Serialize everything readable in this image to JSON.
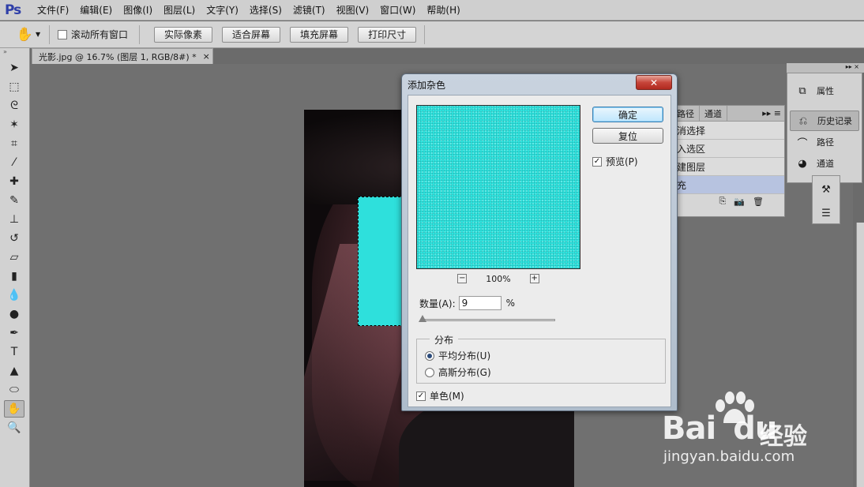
{
  "app": {
    "logo": "Ps"
  },
  "menu": [
    "文件(F)",
    "编辑(E)",
    "图像(I)",
    "图层(L)",
    "文字(Y)",
    "选择(S)",
    "滤镜(T)",
    "视图(V)",
    "窗口(W)",
    "帮助(H)"
  ],
  "options": {
    "scroll_all_label": "滚动所有窗口",
    "scroll_all_checked": false,
    "buttons": [
      "实际像素",
      "适合屏幕",
      "填充屏幕",
      "打印尺寸"
    ]
  },
  "document_tab": {
    "title": "光影.jpg @ 16.7% (图层 1, RGB/8#) *",
    "close": "×"
  },
  "history_panel": {
    "tabs": [
      "路径",
      "通道"
    ],
    "rows": [
      "消选择",
      "入选区",
      "建图层",
      "充"
    ]
  },
  "dock": {
    "items": [
      {
        "label": "属性",
        "icon": "properties-icon"
      },
      {
        "label": "历史记录",
        "icon": "history-icon"
      },
      {
        "label": "路径",
        "icon": "path-icon"
      },
      {
        "label": "通道",
        "icon": "channels-icon"
      }
    ]
  },
  "dialog": {
    "title": "添加杂色",
    "close": "✕",
    "ok_label": "确定",
    "reset_label": "复位",
    "preview_label": "预览(P)",
    "preview_checked": true,
    "zoom_value": "100%",
    "amount_label": "数量(A):",
    "amount_value": "9",
    "amount_unit": "%",
    "distribution_label": "分布",
    "uniform_label": "平均分布(U)",
    "gaussian_label": "高斯分布(G)",
    "selected_distribution": "uniform",
    "mono_label": "单色(M)",
    "mono_checked": true,
    "preview_color": "#2fe3de"
  },
  "watermark": {
    "brand": "Bai",
    "brand_du": "du",
    "cn": "经验",
    "url": "jingyan.baidu.com"
  }
}
